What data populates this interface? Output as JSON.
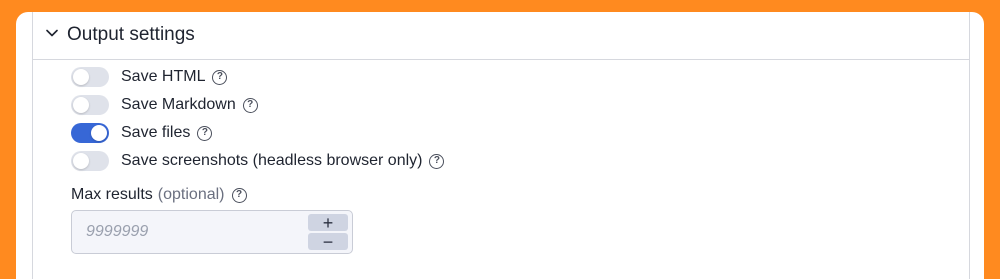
{
  "section": {
    "title": "Output settings",
    "expanded": true
  },
  "options": [
    {
      "label": "Save HTML",
      "enabled": false
    },
    {
      "label": "Save Markdown",
      "enabled": false
    },
    {
      "label": "Save files",
      "enabled": true
    },
    {
      "label": "Save screenshots (headless browser only)",
      "enabled": false
    }
  ],
  "help_glyph": "?",
  "max_results": {
    "label": "Max results",
    "optional_label": "(optional)",
    "value": "",
    "placeholder": "9999999",
    "increment_glyph": "+",
    "decrement_glyph": "−"
  },
  "colors": {
    "frame": "#ff8a1f",
    "toggle_on": "#3767d6",
    "toggle_off": "#dfe2ea"
  },
  "icons": {
    "chevron": "chevron-down-icon",
    "help": "question-circle-icon"
  }
}
